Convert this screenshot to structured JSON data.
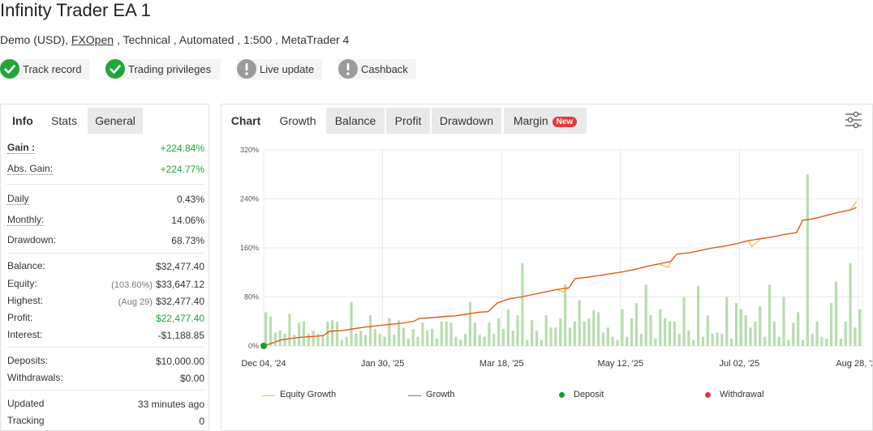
{
  "header": {
    "title": "Infinity Trader EA 1",
    "subtitle_prefix": "Demo (USD),",
    "broker_link": "FXOpen",
    "subtitle_suffix": ", Technical , Automated , 1:500 , MetaTrader 4"
  },
  "badges": [
    {
      "label": "Track record",
      "icon": "check-icon",
      "status": "green"
    },
    {
      "label": "Trading privileges",
      "icon": "check-icon",
      "status": "green"
    },
    {
      "label": "Live update",
      "icon": "exclamation-icon",
      "status": "grey"
    },
    {
      "label": "Cashback",
      "icon": "exclamation-icon",
      "status": "grey"
    }
  ],
  "left_tabs": [
    "Info",
    "Stats",
    "General"
  ],
  "stats": {
    "gain_label": "Gain :",
    "gain_value": "+224.84%",
    "abs_gain_label": "Abs. Gain:",
    "abs_gain_value": "+224.77%",
    "daily_label": "Daily",
    "daily_value": "0.43%",
    "monthly_label": "Monthly:",
    "monthly_value": "14.06%",
    "drawdown_label": "Drawdown:",
    "drawdown_value": "68.73%",
    "balance_label": "Balance:",
    "balance_value": "$32,477.40",
    "equity_label": "Equity:",
    "equity_note": "(103.60%)",
    "equity_value": "$33,647.12",
    "highest_label": "Highest:",
    "highest_note": "(Aug 29)",
    "highest_value": "$32,477.40",
    "profit_label": "Profit:",
    "profit_value": "$22,477.40",
    "interest_label": "Interest:",
    "interest_value": "-$1,188.85",
    "deposits_label": "Deposits:",
    "deposits_value": "$10,000.00",
    "withdrawals_label": "Withdrawals:",
    "withdrawals_value": "$0.00",
    "updated_label": "Updated",
    "updated_value": "33 minutes ago",
    "tracking_label": "Tracking",
    "tracking_value": "0"
  },
  "right_tabs": [
    "Chart",
    "Growth",
    "Balance",
    "Profit",
    "Drawdown",
    "Margin"
  ],
  "new_badge": "New",
  "colors": {
    "accent_green": "#21a53a",
    "equity_line": "#f3c23b",
    "growth_line": "#e0561b",
    "bars": "#b8ddb0",
    "deposit_dot": "#1a9e2e",
    "withdrawal_dot": "#e53535"
  },
  "chart_data": {
    "type": "line",
    "x_tick_labels": [
      "Dec 04, '24",
      "Jan 30, '25",
      "Mar 18, '25",
      "May 12, '25",
      "Jul 02, '25",
      "Aug 28, '25"
    ],
    "y_tick_labels": [
      "0%",
      "80%",
      "160%",
      "240%",
      "320%"
    ],
    "ylim": [
      0,
      320
    ],
    "grid": true,
    "legend": [
      "Equity Growth",
      "Growth",
      "Deposit",
      "Withdrawal"
    ],
    "legend_position": "bottom",
    "series": [
      {
        "name": "Growth",
        "points": [
          [
            0,
            0
          ],
          [
            3,
            5
          ],
          [
            6,
            10
          ],
          [
            9,
            12
          ],
          [
            12,
            14
          ],
          [
            15,
            15
          ],
          [
            18,
            16
          ],
          [
            20,
            17
          ],
          [
            22,
            24
          ],
          [
            26,
            25
          ],
          [
            30,
            28
          ],
          [
            34,
            31
          ],
          [
            38,
            33
          ],
          [
            42,
            35
          ],
          [
            46,
            37
          ],
          [
            50,
            40
          ],
          [
            52,
            45
          ],
          [
            56,
            46
          ],
          [
            60,
            48
          ],
          [
            64,
            49
          ],
          [
            68,
            52
          ],
          [
            72,
            55
          ],
          [
            75,
            56
          ],
          [
            78,
            70
          ],
          [
            82,
            77
          ],
          [
            86,
            80
          ],
          [
            90,
            84
          ],
          [
            94,
            88
          ],
          [
            98,
            92
          ],
          [
            102,
            95
          ],
          [
            104,
            110
          ],
          [
            108,
            112
          ],
          [
            112,
            115
          ],
          [
            116,
            118
          ],
          [
            120,
            121
          ],
          [
            124,
            125
          ],
          [
            128,
            130
          ],
          [
            132,
            134
          ],
          [
            136,
            138
          ],
          [
            138,
            150
          ],
          [
            142,
            152
          ],
          [
            146,
            156
          ],
          [
            150,
            160
          ],
          [
            154,
            163
          ],
          [
            158,
            167
          ],
          [
            162,
            172
          ],
          [
            166,
            175
          ],
          [
            170,
            178
          ],
          [
            174,
            182
          ],
          [
            178,
            185
          ],
          [
            180,
            205
          ],
          [
            184,
            208
          ],
          [
            188,
            213
          ],
          [
            192,
            218
          ],
          [
            196,
            222
          ],
          [
            198,
            226
          ]
        ]
      },
      {
        "name": "Equity Growth",
        "points": [
          [
            0,
            0
          ],
          [
            3,
            5
          ],
          [
            6,
            10
          ],
          [
            9,
            12
          ],
          [
            12,
            14
          ],
          [
            15,
            15
          ],
          [
            18,
            16
          ],
          [
            20,
            17
          ],
          [
            22,
            24
          ],
          [
            26,
            25
          ],
          [
            30,
            28
          ],
          [
            34,
            31
          ],
          [
            38,
            33
          ],
          [
            42,
            35
          ],
          [
            46,
            37
          ],
          [
            50,
            40
          ],
          [
            52,
            45
          ],
          [
            56,
            46
          ],
          [
            60,
            48
          ],
          [
            64,
            49
          ],
          [
            68,
            52
          ],
          [
            72,
            55
          ],
          [
            75,
            56
          ],
          [
            78,
            70
          ],
          [
            82,
            77
          ],
          [
            86,
            80
          ],
          [
            90,
            84
          ],
          [
            94,
            88
          ],
          [
            98,
            92
          ],
          [
            100,
            88
          ],
          [
            102,
            95
          ],
          [
            104,
            110
          ],
          [
            108,
            112
          ],
          [
            112,
            115
          ],
          [
            116,
            118
          ],
          [
            120,
            121
          ],
          [
            124,
            125
          ],
          [
            128,
            130
          ],
          [
            132,
            134
          ],
          [
            135,
            128
          ],
          [
            136,
            138
          ],
          [
            138,
            150
          ],
          [
            142,
            152
          ],
          [
            146,
            156
          ],
          [
            150,
            160
          ],
          [
            154,
            163
          ],
          [
            158,
            167
          ],
          [
            162,
            172
          ],
          [
            163,
            162
          ],
          [
            166,
            175
          ],
          [
            170,
            178
          ],
          [
            174,
            182
          ],
          [
            178,
            185
          ],
          [
            180,
            205
          ],
          [
            184,
            208
          ],
          [
            188,
            213
          ],
          [
            192,
            218
          ],
          [
            196,
            222
          ],
          [
            198,
            236
          ]
        ]
      },
      {
        "name": "Profit bars",
        "values": [
          55,
          48,
          22,
          25,
          20,
          52,
          18,
          38,
          40,
          20,
          25,
          20,
          18,
          40,
          42,
          40,
          10,
          15,
          72,
          20,
          25,
          18,
          50,
          28,
          20,
          15,
          45,
          18,
          42,
          30,
          12,
          28,
          15,
          38,
          25,
          28,
          12,
          40,
          40,
          38,
          15,
          10,
          20,
          72,
          38,
          18,
          15,
          38,
          20,
          45,
          28,
          60,
          25,
          50,
          135,
          10,
          42,
          25,
          10,
          50,
          30,
          30,
          45,
          100,
          30,
          40,
          75,
          40,
          45,
          58,
          55,
          22,
          30,
          15,
          10,
          60,
          15,
          45,
          70,
          20,
          100,
          50,
          12,
          60,
          45,
          40,
          40,
          20,
          80,
          25,
          10,
          98,
          15,
          50,
          20,
          22,
          20,
          80,
          12,
          70,
          60,
          50,
          30,
          40,
          65,
          15,
          100,
          40,
          15,
          80,
          10,
          38,
          55,
          10,
          280,
          20,
          40,
          15,
          12,
          70,
          105,
          12,
          40,
          135,
          30,
          60
        ]
      },
      {
        "name": "Deposit",
        "points": [
          [
            0,
            0
          ]
        ]
      }
    ]
  }
}
